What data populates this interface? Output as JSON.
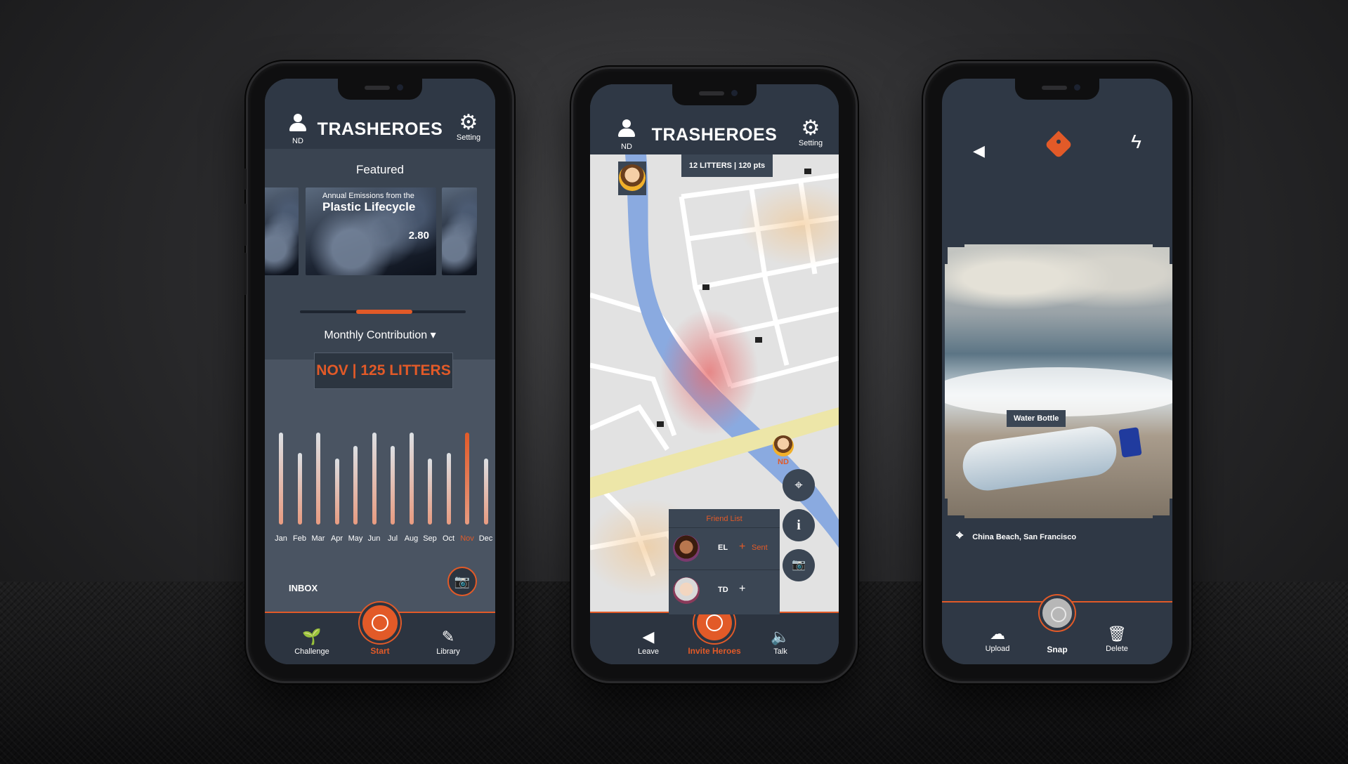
{
  "colors": {
    "accent": "#e25a28",
    "panel": "#3b4654",
    "header": "#2f3845"
  },
  "phone1": {
    "brand": "TRASHEROES",
    "user": "ND",
    "setting": "Setting",
    "featured": "Featured",
    "card": {
      "subtitle": "Annual Emissions from the",
      "title": "Plastic Lifecycle",
      "stat": "2.80"
    },
    "monthly": "Monthly Contribution ▾",
    "highlight": "NOV | 125 LITTERS",
    "months": [
      {
        "label": "Jan",
        "value": 0.82
      },
      {
        "label": "Feb",
        "value": 0.64
      },
      {
        "label": "Mar",
        "value": 0.82
      },
      {
        "label": "Apr",
        "value": 0.59
      },
      {
        "label": "May",
        "value": 0.7
      },
      {
        "label": "Jun",
        "value": 0.82
      },
      {
        "label": "Jul",
        "value": 0.7
      },
      {
        "label": "Aug",
        "value": 0.82
      },
      {
        "label": "Sep",
        "value": 0.59
      },
      {
        "label": "Oct",
        "value": 0.64
      },
      {
        "label": "Nov",
        "value": 0.82
      },
      {
        "label": "Dec",
        "value": 0.59
      }
    ],
    "highlight_month": "Nov",
    "inbox": "INBOX",
    "nav": {
      "left": "Challenge",
      "center": "Start",
      "right": "Library"
    }
  },
  "phone2": {
    "brand": "TRASHEROES",
    "user": "ND",
    "setting": "Setting",
    "stat": "12 LITTERS | 120 pts",
    "pin_label": "ND",
    "friends": {
      "title": "Friend List",
      "items": [
        {
          "name": "EL",
          "status": "Sent"
        },
        {
          "name": "TD",
          "status": ""
        }
      ]
    },
    "nav": {
      "left": "Leave",
      "center": "Invite Heroes",
      "right": "Talk"
    }
  },
  "phone3": {
    "tag": "Water Bottle",
    "location": "China Beach, San Francisco",
    "nav": {
      "left": "Upload",
      "center": "Snap",
      "right": "Delete"
    }
  }
}
